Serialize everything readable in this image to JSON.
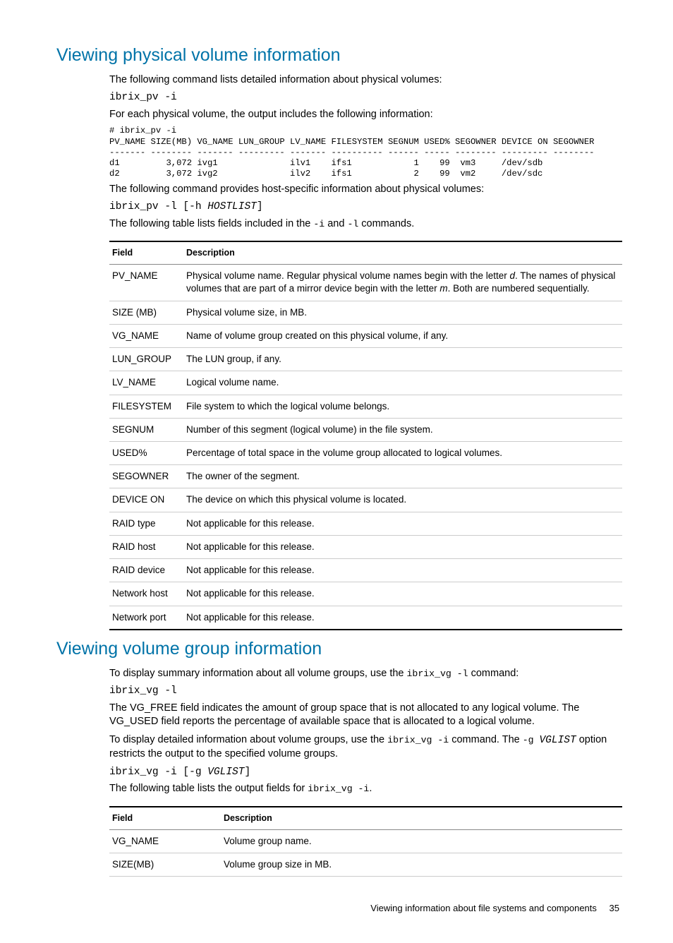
{
  "sections": {
    "pv": {
      "heading": "Viewing physical volume information",
      "intro1": "The following command lists detailed information about physical volumes:",
      "cmd1": "ibrix_pv -i",
      "intro2": "For each physical volume, the output includes the following information:",
      "output": "# ibrix_pv -i\nPV_NAME SIZE(MB) VG_NAME LUN_GROUP LV_NAME FILESYSTEM SEGNUM USED% SEGOWNER DEVICE ON SEGOWNER\n------- -------- ------- --------- ------- ---------- ------ ----- -------- --------- --------\nd1         3,072 ivg1              ilv1    ifs1            1    99  vm3     /dev/sdb\nd2         3,072 ivg2              ilv2    ifs1            2    99  vm2     /dev/sdc",
      "intro3": "The following command provides host-specific information about physical volumes:",
      "cmd2_pre": "ibrix_pv -l [-h ",
      "cmd2_ital": "HOSTLIST",
      "cmd2_post": "]",
      "intro4a": "The following table lists fields included in the ",
      "intro4_i": "-i",
      "intro4b": " and ",
      "intro4_l": "-l",
      "intro4c": " commands.",
      "thField": "Field",
      "thDesc": "Description",
      "rows": [
        {
          "f": "PV_NAME",
          "d_pre": "Physical volume name. Regular physical volume names begin with the letter ",
          "d_em1": "d",
          "d_mid": ". The names of physical volumes that are part of a mirror device begin with the letter ",
          "d_em2": "m",
          "d_post": ". Both are numbered sequentially."
        },
        {
          "f": "SIZE (MB)",
          "d": "Physical volume size, in MB."
        },
        {
          "f": "VG_NAME",
          "d": "Name of volume group created on this physical volume, if any."
        },
        {
          "f": "LUN_GROUP",
          "d": "The LUN group, if any."
        },
        {
          "f": "LV_NAME",
          "d": "Logical volume name."
        },
        {
          "f": "FILESYSTEM",
          "d": "File system to which the logical volume belongs."
        },
        {
          "f": "SEGNUM",
          "d": "Number of this segment (logical volume) in the file system."
        },
        {
          "f": "USED%",
          "d": "Percentage of total space in the volume group allocated to logical volumes."
        },
        {
          "f": "SEGOWNER",
          "d": "The owner of the segment."
        },
        {
          "f": "DEVICE ON",
          "d": "The device on which this physical volume is located."
        },
        {
          "f": "RAID type",
          "d": "Not applicable for this release."
        },
        {
          "f": "RAID host",
          "d": "Not applicable for this release."
        },
        {
          "f": "RAID device",
          "d": "Not applicable for this release."
        },
        {
          "f": "Network host",
          "d": "Not applicable for this release."
        },
        {
          "f": "Network port",
          "d": "Not applicable for this release."
        }
      ]
    },
    "vg": {
      "heading": "Viewing volume group information",
      "intro1a": "To display summary information about all volume groups, use the ",
      "intro1_cmd": "ibrix_vg -l",
      "intro1b": " command:",
      "cmd1": "ibrix_vg -l",
      "para2": "The VG_FREE field indicates the amount of group space that is not allocated to any logical volume. The VG_USED field reports the percentage of available space that is allocated to a logical volume.",
      "para3a": "To display detailed information about volume groups, use the ",
      "para3_cmd": "ibrix_vg -i",
      "para3b": " command. The ",
      "para3_g": "-g ",
      "para3_vglist": "VGLIST",
      "para3c": " option restricts the output to the specified volume groups.",
      "cmd2_pre": "ibrix_vg -i [-g ",
      "cmd2_ital": "VGLIST",
      "cmd2_post": "]",
      "para4a": "The following table lists the output fields for ",
      "para4_cmd": "ibrix_vg -i",
      "para4b": ".",
      "thField": "Field",
      "thDesc": "Description",
      "rows": [
        {
          "f": "VG_NAME",
          "d": "Volume group name."
        },
        {
          "f": "SIZE(MB)",
          "d": "Volume group size in MB."
        }
      ]
    }
  },
  "footer": {
    "text": "Viewing information about file systems and components",
    "page": "35"
  }
}
